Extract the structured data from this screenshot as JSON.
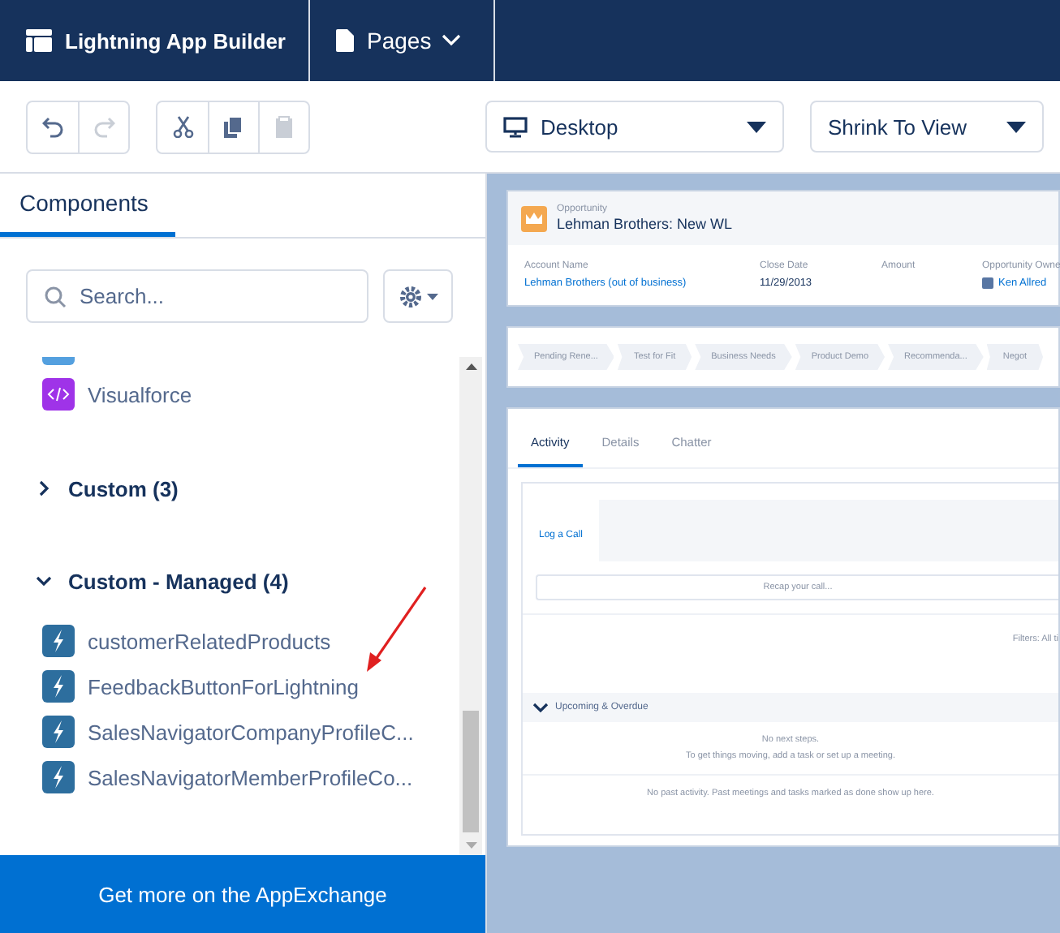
{
  "header": {
    "app_title": "Lightning App Builder",
    "pages_menu": "Pages"
  },
  "toolbar": {
    "groups": [
      [
        {
          "kind": "undo",
          "disabled": false
        },
        {
          "kind": "redo",
          "disabled": true
        }
      ],
      [
        {
          "kind": "cut",
          "disabled": false
        },
        {
          "kind": "copy",
          "disabled": false
        },
        {
          "kind": "paste",
          "disabled": true
        }
      ]
    ],
    "device_select": "Desktop",
    "zoom_select": "Shrink To View"
  },
  "sidebar": {
    "tabs": [
      {
        "label": "Components",
        "selected": true
      }
    ],
    "search": {
      "placeholder": "Search..."
    },
    "items": [
      {
        "label": "Visualforce",
        "kind": "visualforce"
      }
    ],
    "groups": [
      {
        "title": "Custom (3)",
        "expanded": false
      },
      {
        "title": "Custom - Managed (4)",
        "expanded": true,
        "items": [
          {
            "label": "customerRelatedProducts",
            "kind": "lightning"
          },
          {
            "label": "FeedbackButtonForLightning",
            "kind": "lightning"
          },
          {
            "label": "SalesNavigatorCompanyProfileC...",
            "kind": "lightning"
          },
          {
            "label": "SalesNavigatorMemberProfileCo...",
            "kind": "lightning"
          }
        ]
      }
    ],
    "footer_button": "Get more on the AppExchange"
  },
  "preview": {
    "object_label": "Opportunity",
    "title": "Lehman Brothers: New WL",
    "fields": [
      {
        "label": "Account Name",
        "value": "Lehman Brothers (out of business)",
        "kind": "link"
      },
      {
        "label": "Close Date",
        "value": "11/29/2013",
        "kind": "text"
      },
      {
        "label": "Amount"
      },
      {
        "label": "Opportunity Owne",
        "value": "Ken Allred",
        "kind": "user"
      }
    ],
    "path": [
      "Pending Rene...",
      "Test for Fit",
      "Business Needs",
      "Product Demo",
      "Recommenda...",
      "Negot"
    ],
    "tabs": [
      {
        "label": "Activity",
        "selected": true
      },
      {
        "label": "Details",
        "selected": false
      },
      {
        "label": "Chatter",
        "selected": false
      }
    ],
    "activity": {
      "subtabs": [
        {
          "label": "Log a Call",
          "selected": true
        }
      ],
      "placeholder": "Recap your call...",
      "filters": "Filters: All ti",
      "section": "Upcoming & Overdue",
      "empty_lines": [
        "No next steps.",
        "To get things moving, add a task or set up a meeting."
      ],
      "past": "No past activity. Past meetings and tasks marked as done show up here."
    }
  }
}
